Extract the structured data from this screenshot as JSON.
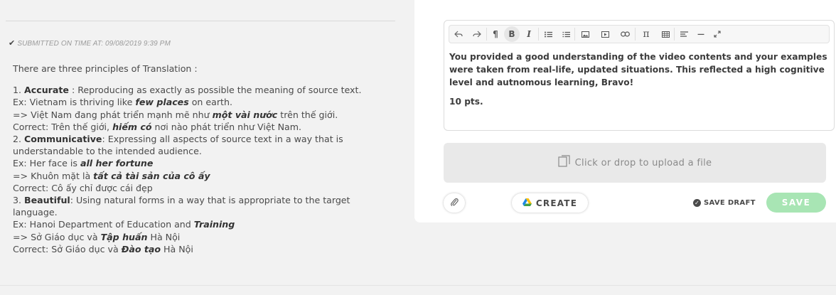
{
  "submission": {
    "check": "✔",
    "status": "SUBMITTED ON TIME AT: 09/08/2019 9:39 PM"
  },
  "answer": {
    "intro": "There are three principles of Translation :",
    "l1_num": "1. ",
    "l1_term": "Accurate",
    "l1_rest": " : Reproducing as exactly as possible the meaning of source text.",
    "l2_pre": "Ex: Vietnam is thriving like ",
    "l2_em": "few places",
    "l2_post": " on earth.",
    "l3_pre": "=> Việt Nam đang phát triển mạnh mẽ như ",
    "l3_em": "một vài nước",
    "l3_post": " trên thế giới.",
    "l4_pre": "Correct: Trên thế giới, ",
    "l4_em": "hiếm có",
    "l4_post": " nơi nào phát triển như Việt Nam.",
    "l5_num": "2. ",
    "l5_term": "Communicative",
    "l5_rest": ": Expressing all aspects of source text in a way that is understandable to the intended audience.",
    "l6_pre": "Ex: Her face is ",
    "l6_em": "all her fortune",
    "l7_pre": "=> Khuôn mặt là ",
    "l7_em": "tất cả tài sản của cô ấy",
    "l8": "Correct: Cô ấy chỉ được cái đẹp",
    "l9_num": "3. ",
    "l9_term": "Beautiful",
    "l9_rest": ": Using natural forms in a way that is appropriate to the target language.",
    "l10_pre": "Ex: Hanoi Department of Education and ",
    "l10_em": "Training",
    "l11_pre": "=> Sở Giáo dục và ",
    "l11_em": "Tập huấn",
    "l11_post": " Hà Nội",
    "l12_pre": "Correct: Sở Giáo dục và ",
    "l12_em": "Đào tạo",
    "l12_post": " Hà Nội"
  },
  "toolbar": {
    "bold_label": "B",
    "italic_label": "I",
    "pilcrow": "¶",
    "pi": "π",
    "dash": "—"
  },
  "feedback": {
    "paragraph1": "You provided a good understanding of the video contents and your examples were taken from real-life, updated situations. This reflected a high cognitive level and autnomous learning, Bravo!",
    "paragraph2": "10 pts."
  },
  "upload": {
    "label": "Click or drop to upload a file"
  },
  "actions": {
    "create_label": "CREATE",
    "save_draft_label": "SAVE DRAFT",
    "save_label": "SAVE"
  },
  "colors": {
    "save_button": "#a8e5b4",
    "upload_bg": "#e9e9e9",
    "page_bg": "#f2f2f2"
  }
}
